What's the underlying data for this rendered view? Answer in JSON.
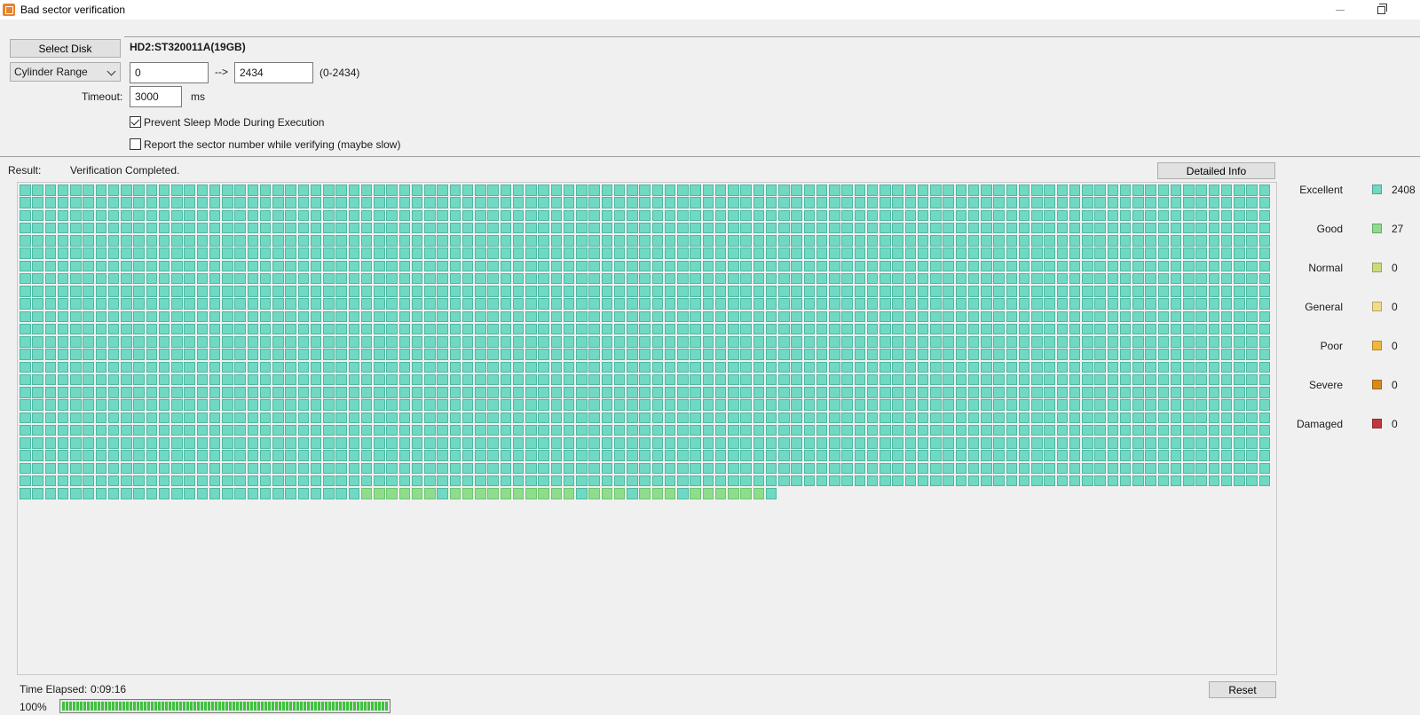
{
  "window": {
    "title": "Bad sector verification"
  },
  "disk": {
    "select_label": "Select Disk",
    "name": "HD2:ST320011A(19GB)"
  },
  "range": {
    "mode": "Cylinder Range",
    "start": "0",
    "arrow": "-->",
    "end": "2434",
    "hint": "(0-2434)"
  },
  "timeout": {
    "label": "Timeout:",
    "value": "3000",
    "unit": "ms"
  },
  "options": {
    "prevent_sleep": {
      "label": "Prevent Sleep Mode During Execution",
      "checked": true
    },
    "report_sector": {
      "label": "Report the sector number while verifying (maybe slow)",
      "checked": false
    }
  },
  "result": {
    "label": "Result:",
    "status": "Verification Completed.",
    "details_button": "Detailed Info"
  },
  "legend": [
    {
      "label": "Excellent",
      "color": "#6fd9c3",
      "count": "2408"
    },
    {
      "label": "Good",
      "color": "#8fdc8f",
      "count": "27"
    },
    {
      "label": "Normal",
      "color": "#c8dc7a",
      "count": "0"
    },
    {
      "label": "General",
      "color": "#f1dc8a",
      "count": "0"
    },
    {
      "label": "Poor",
      "color": "#f2b63a",
      "count": "0"
    },
    {
      "label": "Severe",
      "color": "#d98a1e",
      "count": "0"
    },
    {
      "label": "Damaged",
      "color": "#c0393f",
      "count": "0"
    }
  ],
  "sector_map": {
    "columns": 99,
    "full_rows": 24,
    "last_row": "EEEEEEEEEEEEEEEEEEEEEEEEEEEGGGGGGEGGGGGGGGGGEGGGEGGGEGGGGGGE"
  },
  "footer": {
    "elapsed_label": "Time Elapsed:",
    "elapsed_value": "0:09:16",
    "percent": "100%",
    "progress": 1.0,
    "reset_button": "Reset"
  }
}
